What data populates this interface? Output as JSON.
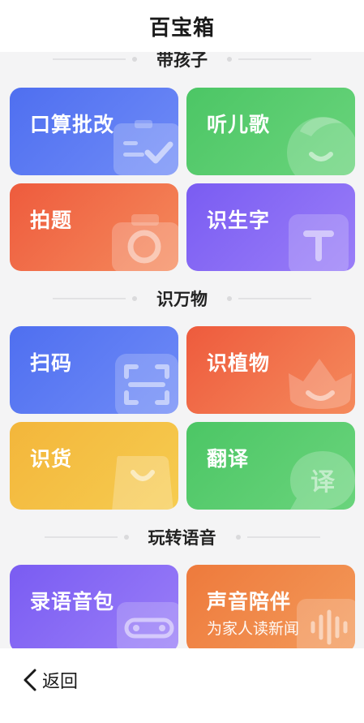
{
  "header": {
    "title": "百宝箱"
  },
  "sections": [
    {
      "label": "带孩子"
    },
    {
      "label": "识万物"
    },
    {
      "label": "玩转语音"
    }
  ],
  "cards": {
    "kousuan": {
      "title": "口算批改",
      "icon": "homework-check-icon"
    },
    "tinger": {
      "title": "听儿歌",
      "icon": "child-face-icon"
    },
    "paiti": {
      "title": "拍题",
      "icon": "camera-icon"
    },
    "shizi": {
      "title": "识生字",
      "icon": "letter-t-icon"
    },
    "saoma": {
      "title": "扫码",
      "icon": "scan-icon"
    },
    "zhiwu": {
      "title": "识植物",
      "icon": "flower-icon"
    },
    "shihuo": {
      "title": "识货",
      "icon": "shopping-bag-icon"
    },
    "fanyi": {
      "title": "翻译",
      "icon": "translate-bubble-icon"
    },
    "luyin": {
      "title": "录语音包",
      "icon": "cassette-icon"
    },
    "peiban": {
      "title": "声音陪伴",
      "subtitle": "为家人读新闻",
      "icon": "sound-wave-icon"
    }
  },
  "colors": {
    "blue": "#4f6ff0",
    "green": "#4cc665",
    "red": "#ee5b3d",
    "purple": "#7a5cf2",
    "yellow": "#f3b63b",
    "orange": "#ee7a3c"
  },
  "footer": {
    "back_label": "返回",
    "icon": "chevron-left-icon"
  }
}
